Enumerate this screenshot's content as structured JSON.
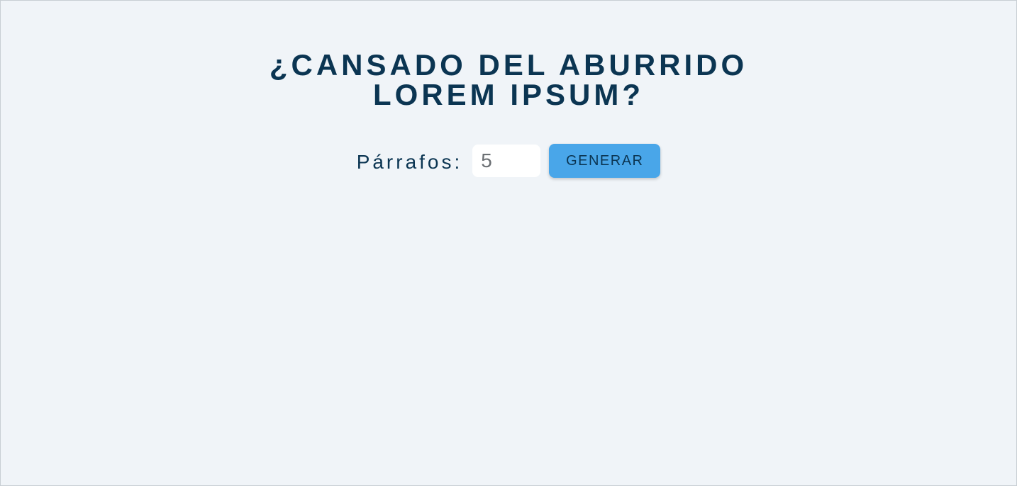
{
  "heading": {
    "title": "¿CANSADO DEL ABURRIDO LOREM IPSUM?"
  },
  "form": {
    "label": "Párrafos:",
    "amount_value": "5",
    "generate_label": "GENERAR"
  },
  "colors": {
    "background": "#f0f4f8",
    "title": "#0b3552",
    "button": "#49a6e9"
  }
}
